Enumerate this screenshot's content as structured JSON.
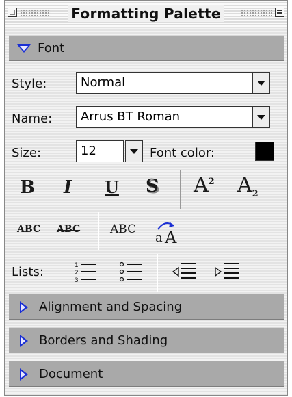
{
  "window": {
    "title": "Formatting Palette"
  },
  "font_section": {
    "header": "Font",
    "style_label": "Style:",
    "style_value": "Normal",
    "name_label": "Name:",
    "name_value": "Arrus BT Roman",
    "size_label": "Size:",
    "size_value": "12",
    "font_color_label": "Font color:",
    "font_color": "#000000",
    "format_buttons": {
      "bold": "B",
      "italic": "I",
      "underline": "U",
      "shadow": "S",
      "superscript_base": "A",
      "superscript_mark": "2",
      "subscript_base": "A",
      "subscript_mark": "2"
    },
    "effect_buttons": {
      "strikethrough": "ABC",
      "double_strikethrough": "ABC",
      "small_caps": "ABC",
      "change_case_lower": "a",
      "change_case_upper": "A"
    },
    "lists_label": "Lists:",
    "list_icons": [
      "numbered-list-icon",
      "bulleted-list-icon",
      "decrease-indent-icon",
      "increase-indent-icon"
    ]
  },
  "collapsed_sections": [
    {
      "label": "Alignment and Spacing"
    },
    {
      "label": "Borders and Shading"
    },
    {
      "label": "Document"
    }
  ],
  "colors": {
    "disclosure_triangle": "#1a2fd4",
    "section_header": "#a9a9a9"
  }
}
